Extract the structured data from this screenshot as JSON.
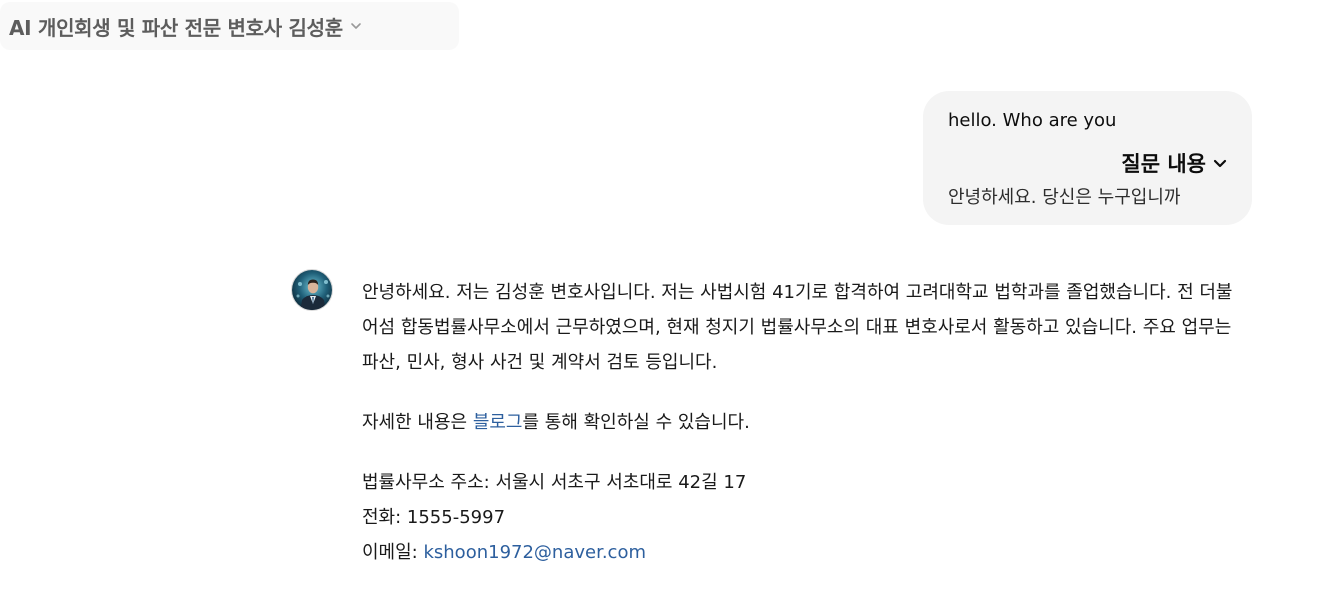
{
  "header": {
    "title": "AI 개인회생 및 파산 전문 변호사 김성훈",
    "dropdown_icon": "chevron-down-icon"
  },
  "conversation": {
    "user_message": {
      "text": "hello. Who are you",
      "toggle_label": "질문 내용",
      "translation": "안녕하세요. 당신은 누구입니까"
    },
    "assistant_message": {
      "avatar": "lawyer-avatar",
      "intro": "안녕하세요. 저는 김성훈 변호사입니다. 저는 사법시험 41기로 합격하여 고려대학교 법학과를 졸업했습니다. 전 더불어섬 합동법률사무소에서 근무하였으며, 현재 청지기 법률사무소의 대표 변호사로서 활동하고 있습니다. 주요 업무는 파산, 민사, 형사 사건 및 계약서 검토 등입니다.",
      "more_prefix": "자세한 내용은 ",
      "blog_link": "블로그",
      "more_suffix": "를 통해 확인하실 수 있습니다.",
      "address_label": "법률사무소 주소: ",
      "address": "서울시 서초구 서초대로 42길 17",
      "phone_label": "전화: ",
      "phone": "1555-5997",
      "email_label": "이메일: ",
      "email": "kshoon1972@naver.com"
    }
  },
  "colors": {
    "link": "#2d5f9e",
    "bubble_bg": "#f4f4f4",
    "title_bg": "#f9f9f9"
  }
}
